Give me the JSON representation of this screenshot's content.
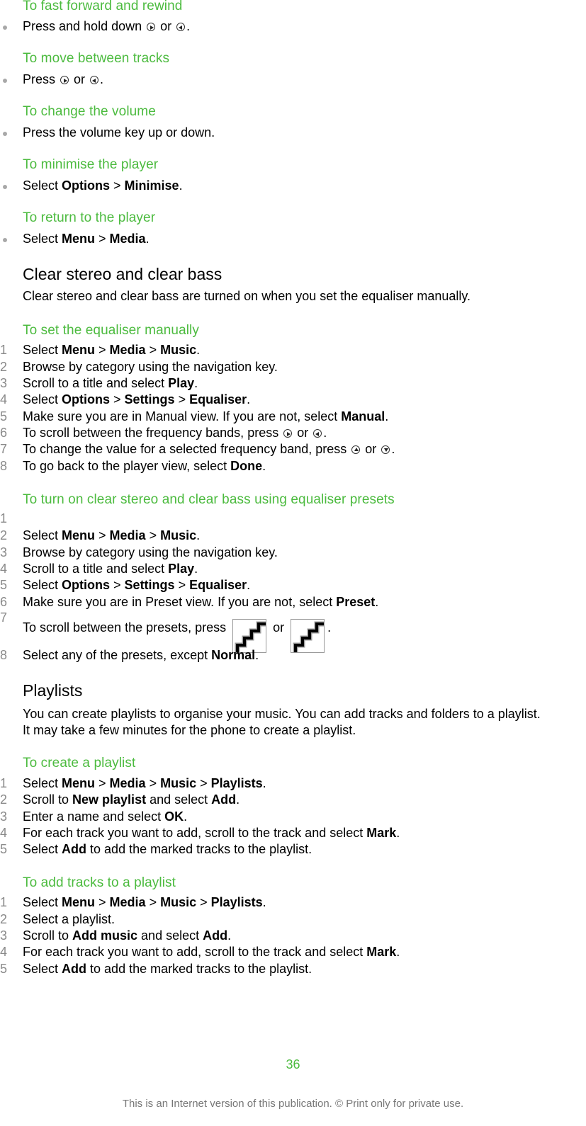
{
  "sections": {
    "fast_forward": {
      "heading": "To fast forward and rewind",
      "bullet": {
        "pre": "Press and hold down ",
        "mid": " or ",
        "post": "."
      }
    },
    "move_tracks": {
      "heading": "To move between tracks",
      "bullet": {
        "pre": "Press ",
        "mid": " or ",
        "post": "."
      }
    },
    "change_volume": {
      "heading": "To change the volume",
      "bullet": "Press the volume key up or down."
    },
    "minimise": {
      "heading": "To minimise the player",
      "bullet": {
        "pre": "Select ",
        "b1": "Options",
        "sep": " > ",
        "b2": "Minimise",
        "post": "."
      }
    },
    "return_player": {
      "heading": "To return to the player",
      "bullet": {
        "pre": "Select ",
        "b1": "Menu",
        "sep": " > ",
        "b2": "Media",
        "post": "."
      }
    },
    "clear_stereo": {
      "title": "Clear stereo and clear bass",
      "paragraph": "Clear stereo and clear bass are turned on when you set the equaliser manually."
    },
    "set_equaliser": {
      "heading": "To set the equaliser manually",
      "steps": [
        {
          "num": "1",
          "pre": "Select ",
          "b1": "Menu",
          "s1": " > ",
          "b2": "Media",
          "s2": " > ",
          "b3": "Music",
          "post": "."
        },
        {
          "num": "2",
          "text": "Browse by category using the navigation key."
        },
        {
          "num": "3",
          "pre": "Scroll to a title and select ",
          "b1": "Play",
          "post": "."
        },
        {
          "num": "4",
          "pre": "Select ",
          "b1": "Options",
          "s1": " > ",
          "b2": "Settings",
          "s2": " > ",
          "b3": "Equaliser",
          "post": "."
        },
        {
          "num": "5",
          "pre": "Make sure you are in Manual view. If you are not, select ",
          "b1": "Manual",
          "post": "."
        },
        {
          "num": "6",
          "pre": "To scroll between the frequency bands, press ",
          "mid": " or ",
          "post": "."
        },
        {
          "num": "7",
          "pre": "To change the value for a selected frequency band, press ",
          "mid": " or ",
          "post": "."
        },
        {
          "num": "8",
          "pre": "To go back to the player view, select ",
          "b1": "Done",
          "post": "."
        }
      ]
    },
    "presets": {
      "heading": "To turn on clear stereo and clear bass using equaliser presets",
      "steps": [
        {
          "num": "1",
          "text": ""
        },
        {
          "num": "2",
          "pre": "Select ",
          "b1": "Menu",
          "s1": " > ",
          "b2": "Media",
          "s2": " > ",
          "b3": "Music",
          "post": "."
        },
        {
          "num": "3",
          "text": "Browse by category using the navigation key."
        },
        {
          "num": "4",
          "pre": "Scroll to a title and select ",
          "b1": "Play",
          "post": "."
        },
        {
          "num": "5",
          "pre": "Select ",
          "b1": "Options",
          "s1": " > ",
          "b2": "Settings",
          "s2": " > ",
          "b3": "Equaliser",
          "post": "."
        },
        {
          "num": "6",
          "pre": "Make sure you are in Preset view. If you are not, select ",
          "b1": "Preset",
          "post": "."
        },
        {
          "num": "7",
          "pre": "To scroll between the presets, press ",
          "mid": " or ",
          "post": "."
        },
        {
          "num": "8",
          "pre": "Select any of the presets, except ",
          "b1": "Normal",
          "post": "."
        }
      ]
    },
    "playlists": {
      "title": "Playlists",
      "paragraph_1": "You can create playlists to organise your music. You can add tracks and folders to a playlist.",
      "paragraph_2": "It may take a few minutes for the phone to create a playlist."
    },
    "create_playlist": {
      "heading": "To create a playlist",
      "steps": [
        {
          "num": "1",
          "pre": "Select ",
          "b1": "Menu",
          "s1": " > ",
          "b2": "Media",
          "s2": " > ",
          "b3": "Music",
          "s3": " > ",
          "b4": "Playlists",
          "post": "."
        },
        {
          "num": "2",
          "pre": "Scroll to ",
          "b1": "New playlist",
          "mid": " and select ",
          "b2": "Add",
          "post": "."
        },
        {
          "num": "3",
          "pre": "Enter a name and select ",
          "b1": "OK",
          "post": "."
        },
        {
          "num": "4",
          "pre": "For each track you want to add, scroll to the track and select ",
          "b1": "Mark",
          "post": "."
        },
        {
          "num": "5",
          "pre": "Select ",
          "b1": "Add",
          "post": " to add the marked tracks to the playlist."
        }
      ]
    },
    "add_tracks": {
      "heading": "To add tracks to a playlist",
      "steps": [
        {
          "num": "1",
          "pre": "Select ",
          "b1": "Menu",
          "s1": " > ",
          "b2": "Media",
          "s2": " > ",
          "b3": "Music",
          "s3": " > ",
          "b4": "Playlists",
          "post": "."
        },
        {
          "num": "2",
          "text": "Select a playlist."
        },
        {
          "num": "3",
          "pre": "Scroll to ",
          "b1": "Add music",
          "mid": " and select ",
          "b2": "Add",
          "post": "."
        },
        {
          "num": "4",
          "pre": "For each track you want to add, scroll to the track and select ",
          "b1": "Mark",
          "post": "."
        },
        {
          "num": "5",
          "pre": "Select ",
          "b1": "Add",
          "post": " to add the marked tracks to the playlist."
        }
      ]
    }
  },
  "footer": {
    "page_number": "36",
    "notice": "This is an Internet version of this publication. © Print only for private use."
  },
  "colors": {
    "heading_green": "#4cbb3f",
    "step_number_gray": "#8a8a8a",
    "bullet_gray": "#a8a8a8",
    "footer_gray": "#777777"
  }
}
